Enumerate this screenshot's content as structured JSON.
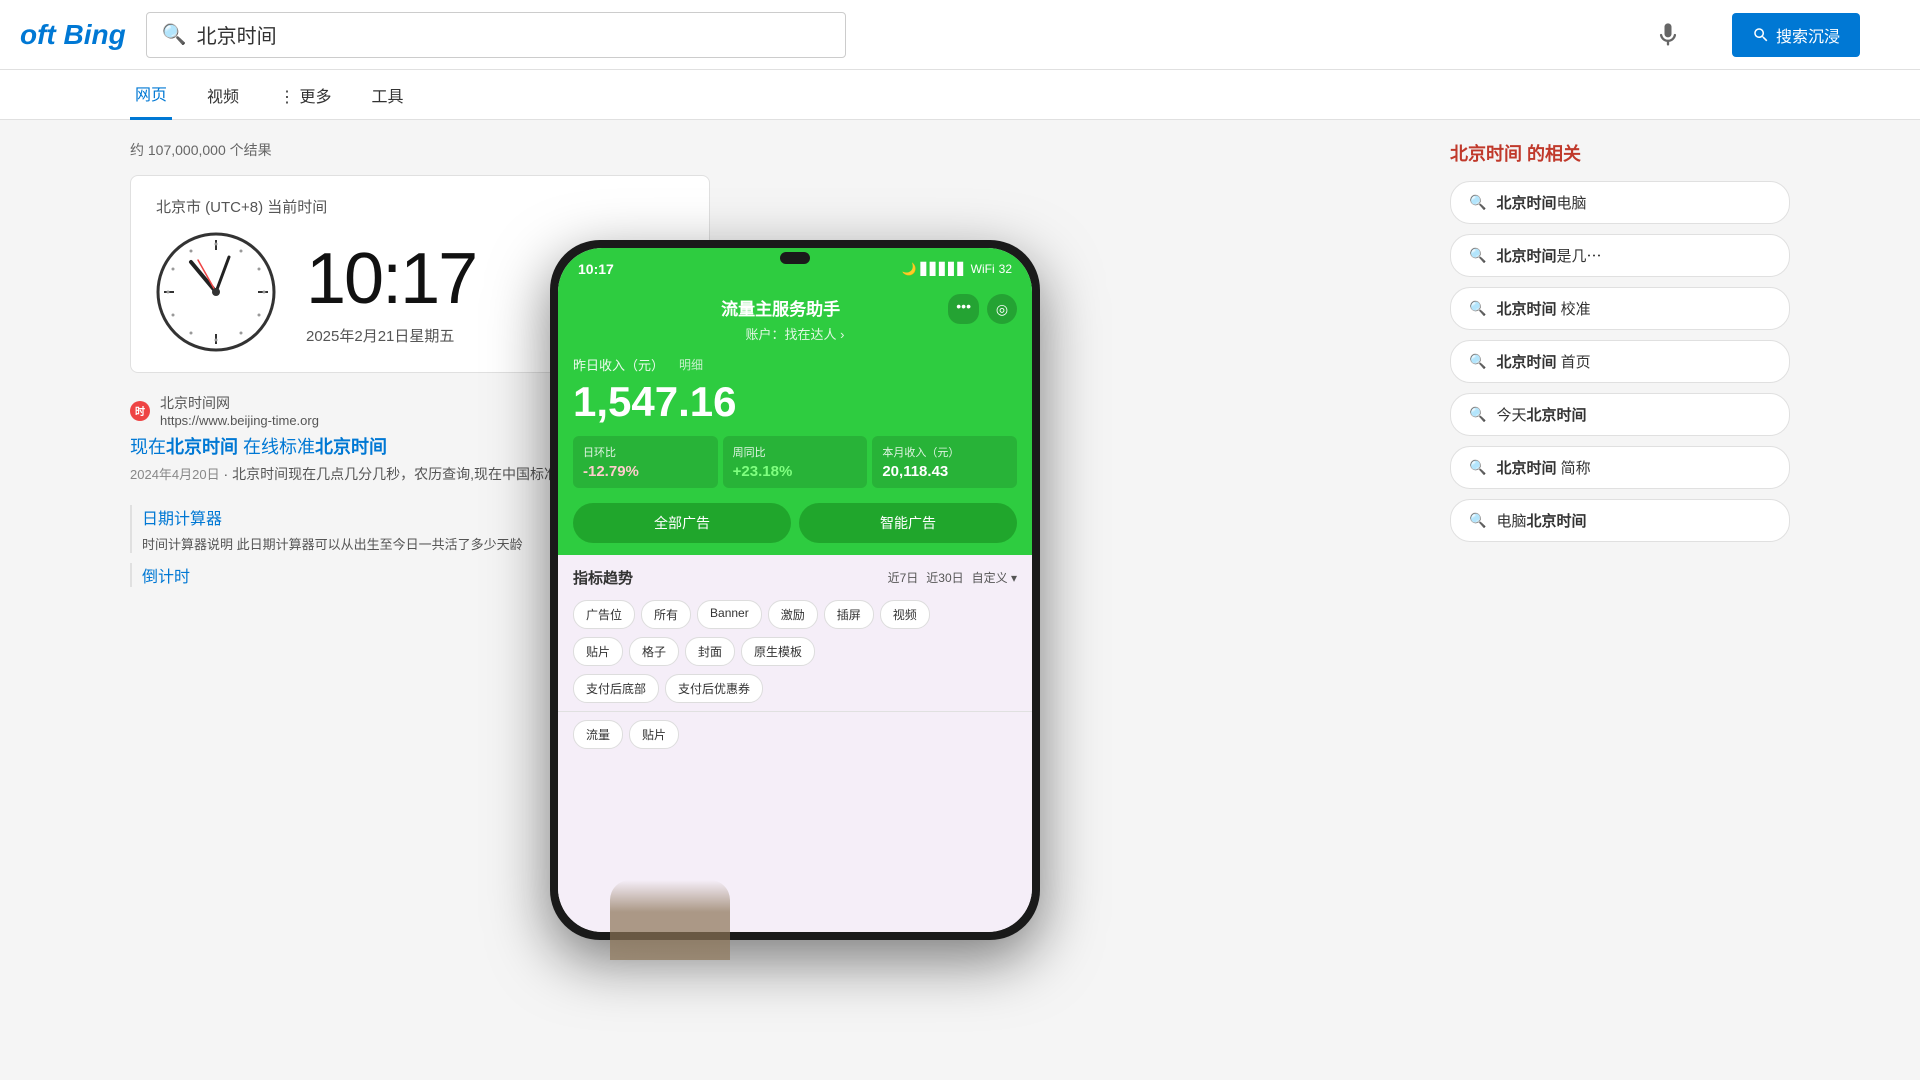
{
  "header": {
    "logo": "oft Bing",
    "search_query": "北京时间",
    "mic_label": "🎤",
    "search_btn_label": "搜索沉浸"
  },
  "nav": {
    "tabs": [
      {
        "label": "网页",
        "active": true
      },
      {
        "label": "视频",
        "active": false
      },
      {
        "label": "⋮ 更多",
        "active": false
      },
      {
        "label": "工具",
        "active": false
      }
    ]
  },
  "results": {
    "count": "约 107,000,000 个结果",
    "time_widget": {
      "title": "北京市 (UTC+8) 当前时间",
      "time": "10:17",
      "date": "2025年2月21日星期五"
    },
    "items": [
      {
        "favicon_text": "时",
        "domain": "北京时间网",
        "url": "https://www.beijing-time.org",
        "title_parts": [
          "现在",
          "北京时间",
          " 在线标准",
          "北京时间"
        ],
        "date": "2024年4月20日",
        "desc": "北京时间现在几点几分几秒，农历查询,现在中国标准时间,当前北京时间校准"
      }
    ],
    "sub_results": [
      {
        "title": "日期计算器",
        "desc": "时间计算器说明 此日期计算器可以从出生至今日一共活了多少天龄"
      },
      {
        "title": "倒计时",
        "desc": ""
      }
    ]
  },
  "related_searches": {
    "title": "北京时间 的相关",
    "items": [
      {
        "text": "北京时间电脑",
        "highlight": "北京时间"
      },
      {
        "text": "北京时间是几⋯",
        "highlight": "北京时间"
      },
      {
        "text": "北京时间 校准",
        "highlight": "北京时间"
      },
      {
        "text": "北京时间 首页",
        "highlight": "北京时间"
      },
      {
        "text": "今天北京时间",
        "highlight": "今天北京时间"
      },
      {
        "text": "北京时间 简称",
        "highlight": "北京时间"
      },
      {
        "text": "电脑北京时间",
        "highlight": "电脑北京时间"
      }
    ]
  },
  "phone": {
    "status_time": "10:17",
    "app_name": "流量主服务助手",
    "account_label": "账户：找在达人 ›",
    "earnings_label": "昨日收入（元）",
    "earnings_detail_label": "明细",
    "amount": "1,547.16",
    "stats": [
      {
        "label": "日环比",
        "value": "-12.79%",
        "type": "negative"
      },
      {
        "label": "周同比",
        "value": "+23.18%",
        "type": "positive"
      },
      {
        "label": "本月收入（元）",
        "value": "20,118.43",
        "type": "neutral"
      }
    ],
    "action_btns": [
      "全部广告",
      "智能广告"
    ],
    "section_title": "指标趋势",
    "time_filters": [
      "近7日",
      "近30日",
      "自定义 ▾"
    ],
    "tags_row1": [
      "广告位",
      "所有",
      "Banner",
      "激励",
      "插屏",
      "视频"
    ],
    "tags_row2": [
      "贴片",
      "格子",
      "封面",
      "原生模板"
    ],
    "tags_row3": [
      "支付后底部",
      "支付后优惠券"
    ],
    "tags_row4": [
      "流量",
      "贴片"
    ]
  },
  "colors": {
    "accent": "#0078d4",
    "phone_green": "#2ecc40",
    "highlight_red": "#c0392b",
    "bing_blue": "#0078d4"
  }
}
